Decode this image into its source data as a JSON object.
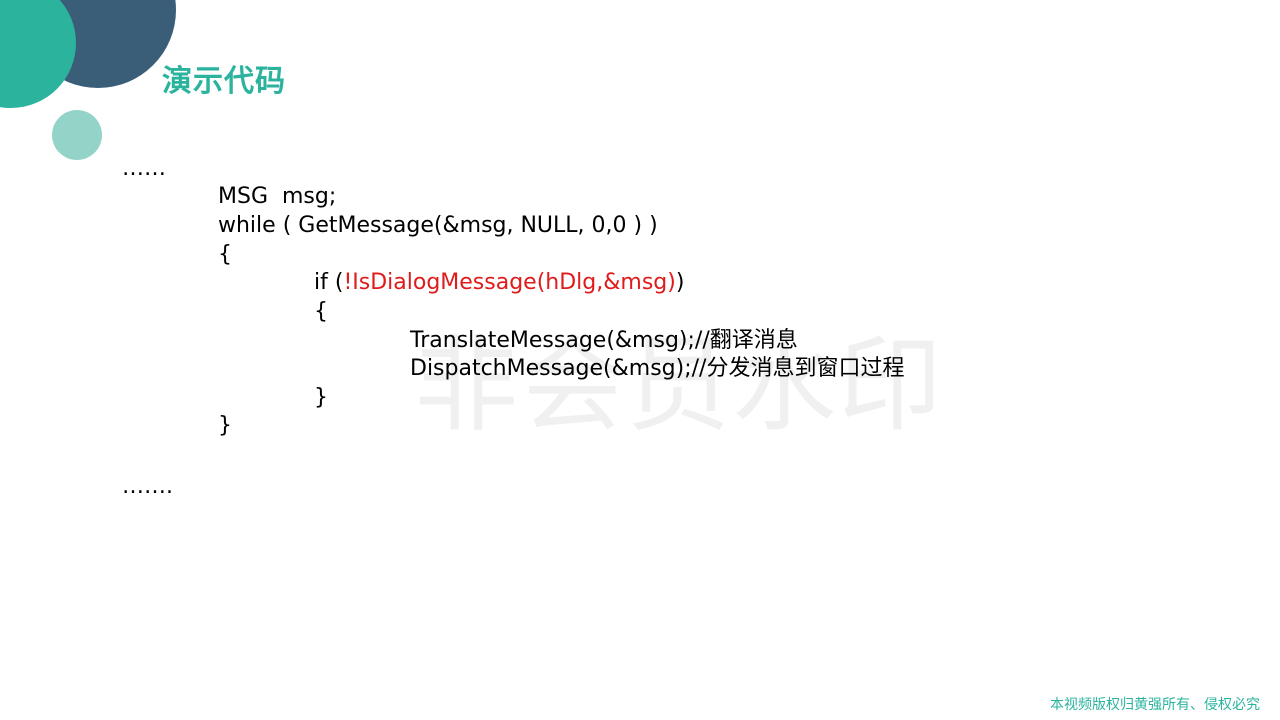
{
  "slide": {
    "title": "演示代码",
    "watermark": "非会员水印",
    "footer": "本视频版权归黄强所有、侵权必究"
  },
  "code": {
    "ellipsis_top": "……",
    "l1": "MSG  msg;",
    "l2": "while ( GetMessage(&msg, NULL, 0,0 ) )",
    "l3": "{",
    "l4_prefix": "if (",
    "l4_highlight": "!IsDialogMessage(hDlg,&msg)",
    "l4_suffix": ")",
    "l5": "{",
    "l6": "TranslateMessage(&msg);//翻译消息",
    "l7": "DispatchMessage(&msg);//分发消息到窗口过程",
    "l8": "}",
    "l9": "}",
    "ellipsis_bottom": "……."
  },
  "colors": {
    "accent": "#2bb39e",
    "dark_circle": "#3a5e78",
    "light_circle": "#93d3c8",
    "highlight": "#e01b1b"
  }
}
